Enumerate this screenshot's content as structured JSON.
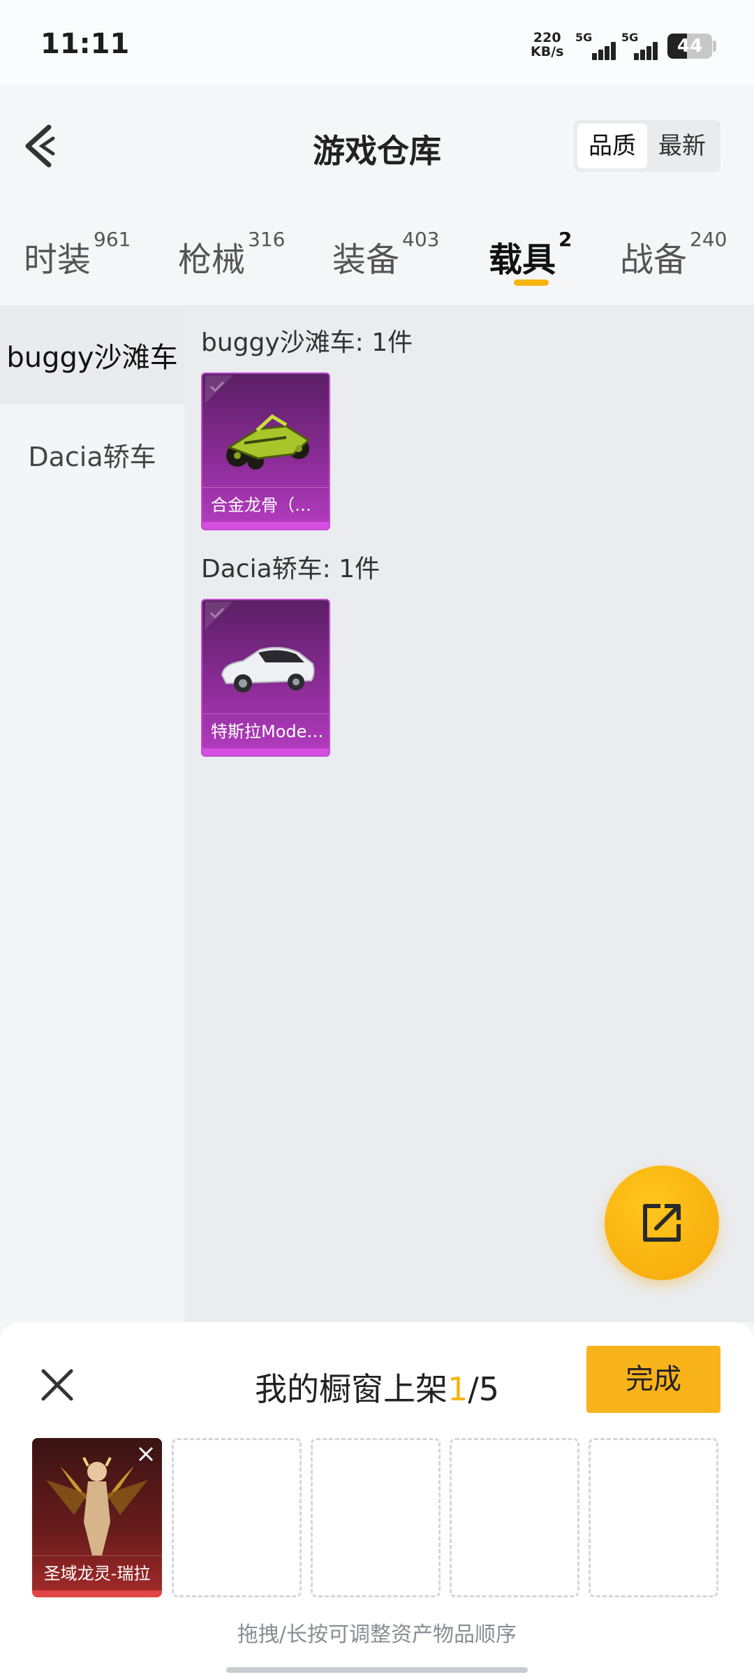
{
  "status_bar": {
    "time": "11:11",
    "net_speed_value": "220",
    "net_speed_unit": "KB/s",
    "signal1_label": "5G",
    "signal2_label": "5G",
    "battery": "44",
    "battery_level": 0.44
  },
  "header": {
    "title": "游戏仓库",
    "sort_options": [
      "品质",
      "最新"
    ],
    "sort_selected": "品质"
  },
  "tabs": [
    {
      "label": "时装",
      "count": "961"
    },
    {
      "label": "枪械",
      "count": "316"
    },
    {
      "label": "装备",
      "count": "403"
    },
    {
      "label": "载具",
      "count": "2",
      "active": true
    },
    {
      "label": "战备",
      "count": "240"
    }
  ],
  "sidebar": {
    "items": [
      {
        "label": "buggy沙滩车",
        "active": true
      },
      {
        "label": "Dacia轿车"
      }
    ]
  },
  "groups": [
    {
      "title": "buggy沙滩车: 1件",
      "items": [
        {
          "name": "合金龙骨（…",
          "rarity_color": "#8b2c96"
        }
      ]
    },
    {
      "title": "Dacia轿车: 1件",
      "items": [
        {
          "name": "特斯拉Mode…",
          "rarity_color": "#8b2c96"
        }
      ]
    }
  ],
  "fab": {
    "icon": "share-icon"
  },
  "showcase": {
    "title_prefix": "我的橱窗上架",
    "current": "1",
    "total": "/5",
    "done_label": "完成",
    "slots": [
      {
        "name": "圣域龙灵-瑞拉",
        "filled": true
      },
      {
        "filled": false
      },
      {
        "filled": false
      },
      {
        "filled": false
      },
      {
        "filled": false
      }
    ],
    "hint": "拖拽/长按可调整资产物品顺序"
  }
}
